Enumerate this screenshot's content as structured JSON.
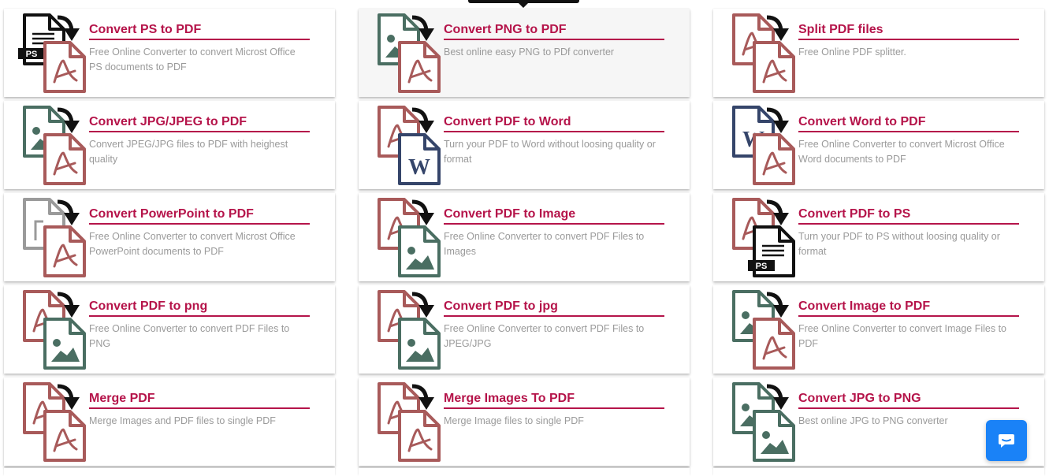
{
  "tools": [
    {
      "title": "Convert PS to PDF",
      "desc": "Free Online Converter to convert Microst Office PS documents to PDF",
      "from": "ps",
      "to": "pdf",
      "from_name": "ps-file-icon",
      "to_name": "pdf-file-icon"
    },
    {
      "title": "Convert PNG to PDF",
      "desc": "Best online easy PNG to PDf converter",
      "from": "image",
      "to": "pdf",
      "from_name": "image-file-icon",
      "to_name": "pdf-file-icon",
      "hover": true
    },
    {
      "title": "Split PDF files",
      "desc": "Free Online PDF splitter.",
      "from": "pdf",
      "to": "pdf",
      "from_name": "pdf-file-icon",
      "to_name": "pdf-file-icon"
    },
    {
      "title": "Convert JPG/JPEG to PDF",
      "desc": "Convert JPEG/JPG files to PDF with heighest quality",
      "from": "image",
      "to": "pdf",
      "from_name": "image-file-icon",
      "to_name": "pdf-file-icon"
    },
    {
      "title": "Convert PDF to Word",
      "desc": "Turn your PDF to Word without loosing quality or format",
      "from": "pdf",
      "to": "word",
      "from_name": "pdf-file-icon",
      "to_name": "word-file-icon"
    },
    {
      "title": "Convert Word to PDF",
      "desc": "Free Online Converter to convert Microst Office Word documents to PDF",
      "from": "word",
      "to": "pdf",
      "from_name": "word-file-icon",
      "to_name": "pdf-file-icon"
    },
    {
      "title": "Convert PowerPoint to PDF",
      "desc": "Free Online Converter to convert Microst Office PowerPoint documents to PDF",
      "from": "ppt",
      "to": "pdf",
      "from_name": "powerpoint-file-icon",
      "to_name": "pdf-file-icon"
    },
    {
      "title": "Convert PDF to Image",
      "desc": "Free Online Converter to convert PDF Files to Images",
      "from": "pdf",
      "to": "image",
      "from_name": "pdf-file-icon",
      "to_name": "image-file-icon"
    },
    {
      "title": "Convert PDF to PS",
      "desc": "Turn your PDF to PS without loosing quality or format",
      "from": "pdf",
      "to": "ps",
      "from_name": "pdf-file-icon",
      "to_name": "ps-file-icon"
    },
    {
      "title": "Convert PDF to png",
      "desc": "Free Online Converter to convert PDF Files to PNG",
      "from": "pdf",
      "to": "image",
      "from_name": "pdf-file-icon",
      "to_name": "image-file-icon"
    },
    {
      "title": "Convert PDF to jpg",
      "desc": "Free Online Converter to convert PDF Files to JPEG/JPG",
      "from": "pdf",
      "to": "image",
      "from_name": "pdf-file-icon",
      "to_name": "image-file-icon"
    },
    {
      "title": "Convert Image to PDF",
      "desc": "Free Online Converter to convert Image Files to PDF",
      "from": "image",
      "to": "pdf",
      "from_name": "image-file-icon",
      "to_name": "pdf-file-icon"
    },
    {
      "title": "Merge PDF",
      "desc": "Merge Images and PDF files to single PDF",
      "from": "pdf",
      "to": "pdf",
      "from_name": "pdf-file-icon",
      "to_name": "pdf-file-icon"
    },
    {
      "title": "Merge Images To PDF",
      "desc": "Merge Image files to single PDF",
      "from": "pdf",
      "to": "pdf",
      "from_name": "pdf-file-icon",
      "to_name": "pdf-file-icon"
    },
    {
      "title": "Convert JPG to PNG",
      "desc": "Best online JPG to PNG converter",
      "from": "image",
      "to": "image",
      "from_name": "image-file-icon",
      "to_name": "image-file-icon"
    }
  ],
  "icon_labels": {
    "ps": "PS",
    "word": "W"
  },
  "colors": {
    "pdf": "#a85a5a",
    "image": "#4a6e62",
    "word": "#35456a",
    "ppt": "#9a9a9a",
    "ps": "#111111",
    "accent": "#b5144a",
    "chat": "#1a82f7"
  },
  "chat": {
    "icon": "chat-bubble-icon"
  }
}
